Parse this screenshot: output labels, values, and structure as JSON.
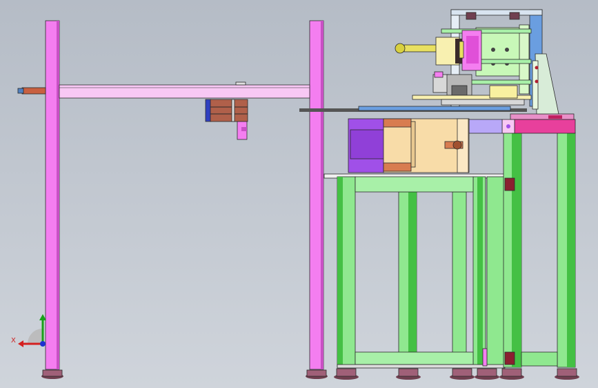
{
  "viewport": {
    "background": "#c3c9d1"
  },
  "triad": {
    "x_label": "X",
    "x_color": "#d42020",
    "y_color": "#1aa01a",
    "z_color": "#2030d0"
  },
  "colors": {
    "frame_pink": "#f47ef0",
    "frame_green": "#8fe88f",
    "frame_dark_green": "#44c044",
    "motor_purple": "#a050e8",
    "gearbox_tan": "#f8dca8",
    "top_table_pink": "#e8409c",
    "block_brown": "#b0604a",
    "plate_blue": "#6a9ee0",
    "bolt_yellow": "#e8e060",
    "foot_dark": "#704050",
    "mount_blue": "#3040c0"
  }
}
